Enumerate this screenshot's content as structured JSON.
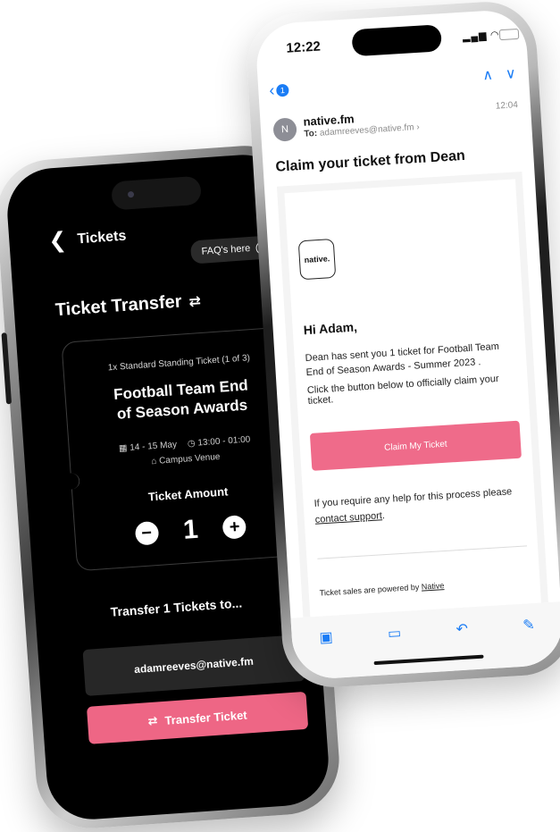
{
  "ticket_app": {
    "header_title": "Tickets",
    "back_icon": "chevron-left-icon",
    "faq_label": "FAQ's here",
    "page_title": "Ticket Transfer",
    "ticket_type": "1x Standard Standing Ticket (1 of 3)",
    "event_name_line1": "Football Team End",
    "event_name_line2": "of Season Awards",
    "event_dates": "14 - 15 May",
    "event_time": "13:00 - 01:00",
    "venue": "Campus Venue",
    "amount_label": "Ticket Amount",
    "amount_value": "1",
    "transfer_to_label": "Transfer 1 Tickets to...",
    "recipient_email": "adamreeves@native.fm",
    "transfer_button_label": "Transfer Ticket",
    "accent_color": "#ee6685"
  },
  "mail_app": {
    "status_time": "12:22",
    "back_badge_count": "1",
    "sender_initial": "N",
    "sender_name": "native.fm",
    "to_label": "To:",
    "to_address": "adamreeves@native.fm",
    "received_time": "12:04",
    "subject": "Claim your ticket from Dean",
    "logo_text": "native.",
    "greeting": "Hi Adam,",
    "body_line1": "Dean has sent you 1 ticket for Football Team End of Season Awards - Summer 2023 .",
    "body_line2": "Click the button below to officially claim your ticket.",
    "claim_button_label": "Claim My Ticket",
    "help_text": "If you require any help for this process please",
    "help_link": "contact support",
    "powered_text": "Ticket sales are powered by",
    "powered_link": "Native",
    "accent_color": "#ef6b8a",
    "link_color": "#1a7cf5"
  }
}
